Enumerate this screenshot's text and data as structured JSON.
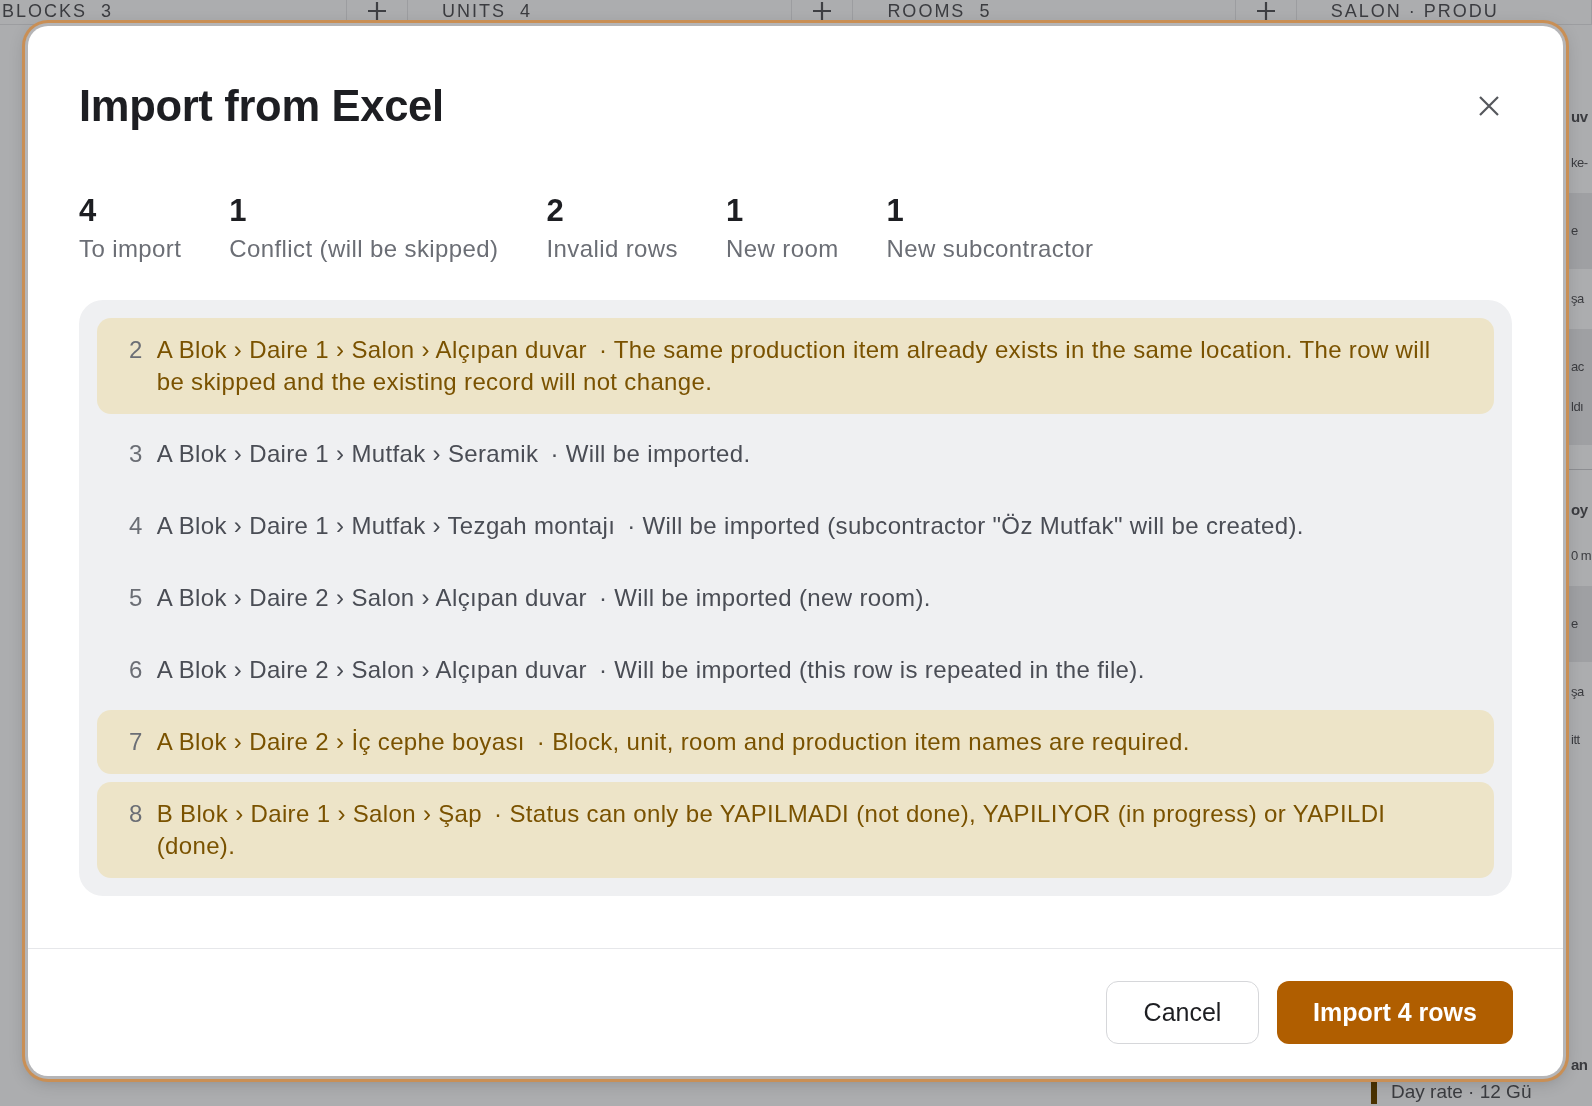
{
  "background": {
    "columns": [
      {
        "label": "BLOCKS",
        "count": "3",
        "addable": true
      },
      {
        "label": "UNITS",
        "count": "4",
        "addable": true
      },
      {
        "label": "ROOMS",
        "count": "5",
        "addable": true
      },
      {
        "label": "SALON · PRODU",
        "addable": false
      }
    ],
    "side_items": [
      {
        "kind": "title",
        "text": "uv"
      },
      {
        "kind": "text",
        "text": "ke-"
      },
      {
        "kind": "band",
        "lines": [
          "e"
        ]
      },
      {
        "kind": "text",
        "text": "şa"
      },
      {
        "kind": "band",
        "lines": [
          "ac",
          "ldı"
        ]
      },
      {
        "kind": "divider"
      },
      {
        "kind": "title",
        "text": "oy"
      },
      {
        "kind": "text",
        "text": "0 m"
      },
      {
        "kind": "band",
        "lines": [
          "e"
        ]
      },
      {
        "kind": "text",
        "text": "şa"
      },
      {
        "kind": "text",
        "text": "itt"
      },
      {
        "kind": "card",
        "title": "an",
        "caption": "Day rate · 12 Gü"
      }
    ]
  },
  "dialog": {
    "title": "Import from Excel",
    "stats": [
      {
        "value": "4",
        "label": "To import"
      },
      {
        "value": "1",
        "label": "Conflict (will be skipped)"
      },
      {
        "value": "2",
        "label": "Invalid rows"
      },
      {
        "value": "1",
        "label": "New room"
      },
      {
        "value": "1",
        "label": "New subcontractor"
      }
    ],
    "rows": [
      {
        "number": "2",
        "path": "A Blok › Daire 1 › Salon › Alçıpan duvar",
        "message": "· The same production item already exists in the same location. The row will be skipped and the existing record will not change.",
        "kind": "conflict"
      },
      {
        "number": "3",
        "path": "A Blok › Daire 1 › Mutfak › Seramik",
        "message": "· Will be imported.",
        "kind": "ok"
      },
      {
        "number": "4",
        "path": "A Blok › Daire 1 › Mutfak › Tezgah montajı",
        "message": "· Will be imported (subcontractor \"Öz Mutfak\" will be created).",
        "kind": "ok"
      },
      {
        "number": "5",
        "path": "A Blok › Daire 2 › Salon › Alçıpan duvar",
        "message": "· Will be imported (new room).",
        "kind": "ok"
      },
      {
        "number": "6",
        "path": "A Blok › Daire 2 › Salon › Alçıpan duvar",
        "message": "· Will be imported (this row is repeated in the file).",
        "kind": "ok"
      },
      {
        "number": "7",
        "path": "A Blok › Daire 2 › İç cephe boyası",
        "message": "· Block, unit, room and production item names are required.",
        "kind": "invalid"
      },
      {
        "number": "8",
        "path": "B Blok › Daire 1 › Salon › Şap",
        "message": "· Status can only be YAPILMADI (not done), YAPILIYOR (in progress) or YAPILDI (done).",
        "kind": "invalid"
      }
    ],
    "buttons": [
      {
        "label": "Cancel",
        "kind": "secondary"
      },
      {
        "label": "Import 4 rows",
        "kind": "primary"
      }
    ]
  }
}
